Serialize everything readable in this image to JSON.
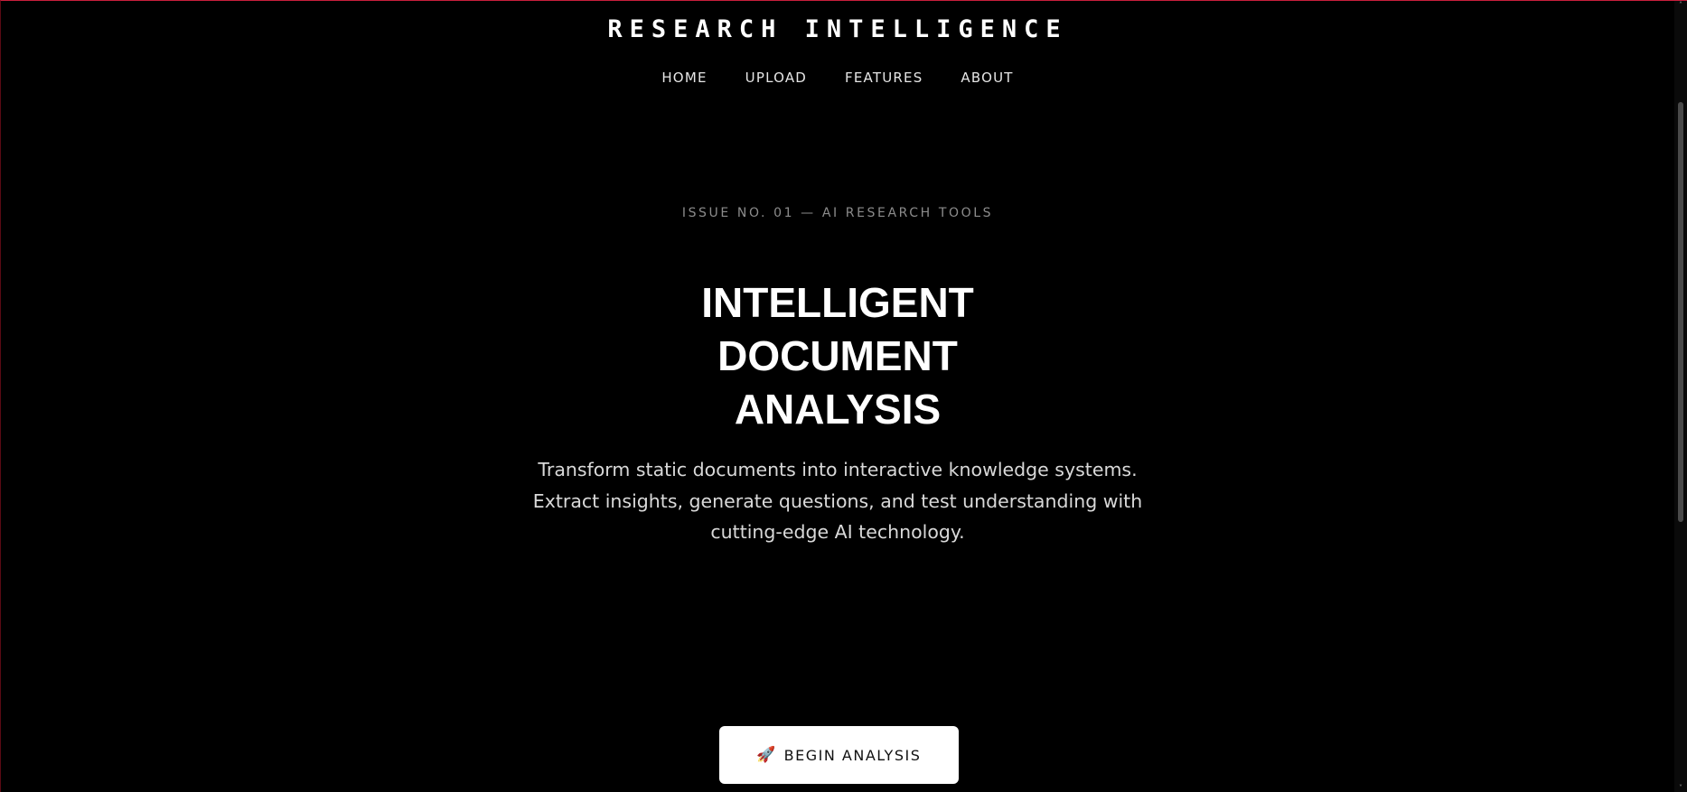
{
  "header": {
    "brand": "RESEARCH INTELLIGENCE",
    "nav": [
      {
        "label": "HOME"
      },
      {
        "label": "UPLOAD"
      },
      {
        "label": "FEATURES"
      },
      {
        "label": "ABOUT"
      }
    ]
  },
  "hero": {
    "issue": "ISSUE NO. 01 — AI RESEARCH TOOLS",
    "headline_lines": [
      "INTELLIGENT",
      "DOCUMENT",
      "ANALYSIS"
    ],
    "subtext": "Transform static documents into interactive knowledge systems. Extract insights, generate questions, and test understanding with cutting-edge AI technology.",
    "cta": {
      "icon": "rocket-icon",
      "glyph": "🚀",
      "label": "BEGIN ANALYSIS"
    }
  },
  "colors": {
    "background": "#000000",
    "text": "#ffffff",
    "muted": "#8c8c8c",
    "button_bg": "#ffffff",
    "accent_border": "#c81e3c"
  },
  "scrollbar": {
    "up_glyph": "˄",
    "down_glyph": "˅"
  }
}
